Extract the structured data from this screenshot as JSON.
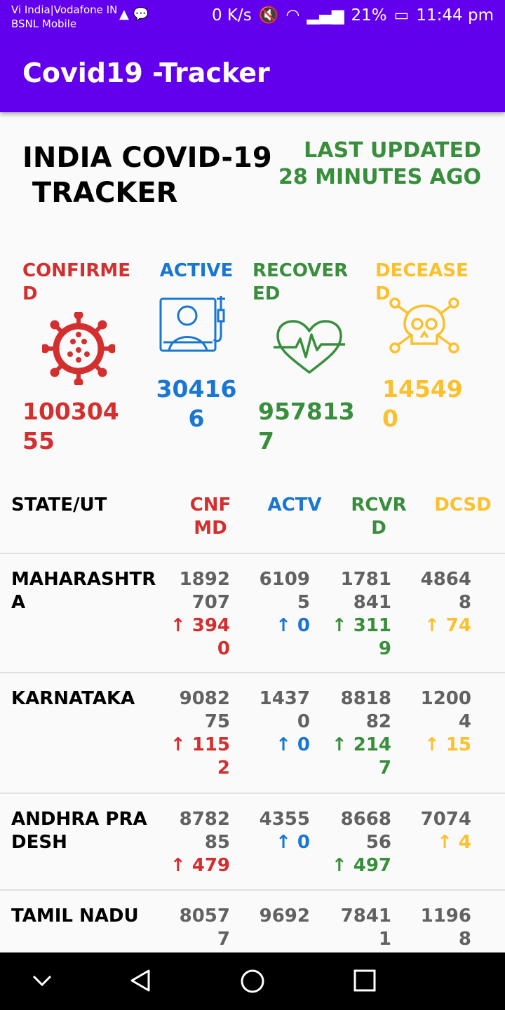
{
  "status_bar": {
    "carrier1": "Vi India|Vodafone IN",
    "carrier2": "BSNL Mobile",
    "speed": "0 K/s",
    "battery": "21%",
    "time": "11:44 pm"
  },
  "app_bar": {
    "title": "Covid19 -Tracker"
  },
  "header": {
    "title": "INDIA COVID-19\n TRACKER",
    "last_updated": "LAST UPDATED 28 MINUTES AGO"
  },
  "stats": {
    "confirmed": {
      "label": "CONFIRMED",
      "value": "10030455",
      "icon": "virus-icon",
      "color": "#d32f2f"
    },
    "active": {
      "label": "ACTIVE",
      "value": "304166",
      "icon": "patient-bed-icon",
      "color": "#1976d2"
    },
    "recovered": {
      "label": "RECOVERED",
      "value": "9578137",
      "icon": "heartbeat-icon",
      "color": "#388e3c"
    },
    "deceased": {
      "label": "DECEASED",
      "value": "145490",
      "icon": "skull-icon",
      "color": "#fbc02d"
    }
  },
  "table": {
    "headers": {
      "state": "STATE/UT",
      "confirmed": "CNFMD",
      "active": "ACTV",
      "recovered": "RCVRD",
      "deceased": "DCSD"
    },
    "rows": [
      {
        "state": "MAHARASHTRA",
        "confirmed": "1892707",
        "confirmed_delta": "↑ 3940",
        "active": "61095",
        "active_delta": "↑ 0",
        "recovered": "1781841",
        "recovered_delta": "↑ 3119",
        "deceased": "48648",
        "deceased_delta": "↑ 74"
      },
      {
        "state": "KARNATAKA",
        "confirmed": "908275",
        "confirmed_delta": "↑ 1152",
        "active": "14370",
        "active_delta": "↑ 0",
        "recovered": "881882",
        "recovered_delta": "↑ 2147",
        "deceased": "12004",
        "deceased_delta": "↑ 15"
      },
      {
        "state": "ANDHRA PRADESH",
        "confirmed": "878285",
        "confirmed_delta": "↑ 479",
        "active": "4355",
        "active_delta": "↑ 0",
        "recovered": "866856",
        "recovered_delta": "↑ 497",
        "deceased": "7074",
        "deceased_delta": "↑ 4"
      },
      {
        "state": "TAMIL NADU",
        "confirmed": "80577",
        "confirmed_delta": "",
        "active": "9692",
        "active_delta": "",
        "recovered": "78411",
        "recovered_delta": "",
        "deceased": "11968",
        "deceased_delta": ""
      }
    ]
  },
  "colors": {
    "primary": "#6200ee",
    "confirmed": "#d32f2f",
    "active": "#1976d2",
    "recovered": "#388e3c",
    "deceased": "#fbc02d"
  }
}
